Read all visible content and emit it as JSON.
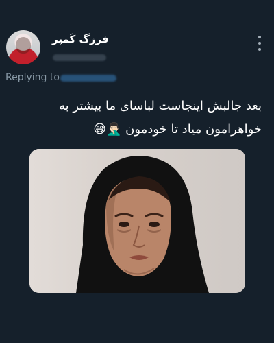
{
  "header": {
    "display_name": "فرزگ کَمپر"
  },
  "reply": {
    "label": "Replying to"
  },
  "tweet": {
    "line1": "بعد جالبش اینجاست لباسای ما بیشتر به",
    "line2": "خواهرامون میاد تا خودمون 🤦🏻‍♂️😅"
  },
  "icons": {
    "more": "more-vertical-icon"
  },
  "colors": {
    "background": "#15202b",
    "secondary_text": "#8899a6",
    "link": "#1d9bf0"
  }
}
